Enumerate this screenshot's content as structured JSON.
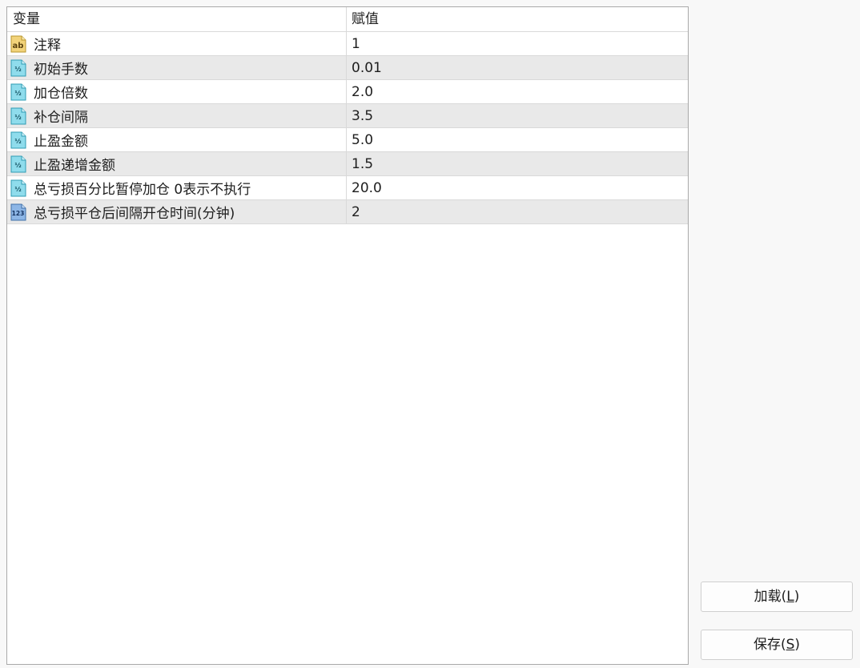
{
  "table": {
    "headers": {
      "variable": "变量",
      "value": "赋值"
    },
    "rows": [
      {
        "icon": "string-type-icon",
        "name": "注释",
        "value": "1"
      },
      {
        "icon": "double-type-icon",
        "name": "初始手数",
        "value": "0.01"
      },
      {
        "icon": "double-type-icon",
        "name": "加仓倍数",
        "value": "2.0"
      },
      {
        "icon": "double-type-icon",
        "name": "补仓间隔",
        "value": "3.5"
      },
      {
        "icon": "double-type-icon",
        "name": "止盈金额",
        "value": "5.0"
      },
      {
        "icon": "double-type-icon",
        "name": "止盈递增金额",
        "value": "1.5"
      },
      {
        "icon": "double-type-icon",
        "name": "总亏损百分比暂停加仓 0表示不执行",
        "value": "20.0"
      },
      {
        "icon": "integer-type-icon",
        "name": "总亏损平仓后间隔开仓时间(分钟)",
        "value": "2"
      }
    ]
  },
  "buttons": {
    "load": {
      "label": "加载(",
      "mnemonic": "L",
      "suffix": ")"
    },
    "save": {
      "label": "保存(",
      "mnemonic": "S",
      "suffix": ")"
    }
  },
  "colors": {
    "row_alt": "#e9e9e9",
    "grid_line": "#d9d9d9",
    "string_icon": "#e8c96a",
    "double_icon": "#7fd3e6",
    "integer_icon": "#6f9fd6"
  }
}
